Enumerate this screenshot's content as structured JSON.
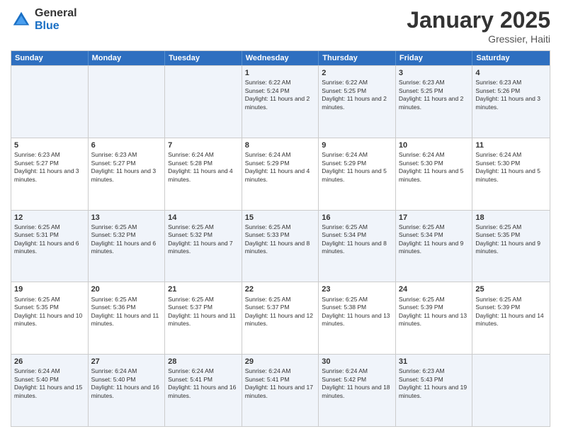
{
  "header": {
    "logo_general": "General",
    "logo_blue": "Blue",
    "month_title": "January 2025",
    "subtitle": "Gressier, Haiti"
  },
  "weekdays": [
    "Sunday",
    "Monday",
    "Tuesday",
    "Wednesday",
    "Thursday",
    "Friday",
    "Saturday"
  ],
  "rows": [
    [
      {
        "day": "",
        "info": ""
      },
      {
        "day": "",
        "info": ""
      },
      {
        "day": "",
        "info": ""
      },
      {
        "day": "1",
        "info": "Sunrise: 6:22 AM\nSunset: 5:24 PM\nDaylight: 11 hours and 2 minutes."
      },
      {
        "day": "2",
        "info": "Sunrise: 6:22 AM\nSunset: 5:25 PM\nDaylight: 11 hours and 2 minutes."
      },
      {
        "day": "3",
        "info": "Sunrise: 6:23 AM\nSunset: 5:25 PM\nDaylight: 11 hours and 2 minutes."
      },
      {
        "day": "4",
        "info": "Sunrise: 6:23 AM\nSunset: 5:26 PM\nDaylight: 11 hours and 3 minutes."
      }
    ],
    [
      {
        "day": "5",
        "info": "Sunrise: 6:23 AM\nSunset: 5:27 PM\nDaylight: 11 hours and 3 minutes."
      },
      {
        "day": "6",
        "info": "Sunrise: 6:23 AM\nSunset: 5:27 PM\nDaylight: 11 hours and 3 minutes."
      },
      {
        "day": "7",
        "info": "Sunrise: 6:24 AM\nSunset: 5:28 PM\nDaylight: 11 hours and 4 minutes."
      },
      {
        "day": "8",
        "info": "Sunrise: 6:24 AM\nSunset: 5:29 PM\nDaylight: 11 hours and 4 minutes."
      },
      {
        "day": "9",
        "info": "Sunrise: 6:24 AM\nSunset: 5:29 PM\nDaylight: 11 hours and 5 minutes."
      },
      {
        "day": "10",
        "info": "Sunrise: 6:24 AM\nSunset: 5:30 PM\nDaylight: 11 hours and 5 minutes."
      },
      {
        "day": "11",
        "info": "Sunrise: 6:24 AM\nSunset: 5:30 PM\nDaylight: 11 hours and 5 minutes."
      }
    ],
    [
      {
        "day": "12",
        "info": "Sunrise: 6:25 AM\nSunset: 5:31 PM\nDaylight: 11 hours and 6 minutes."
      },
      {
        "day": "13",
        "info": "Sunrise: 6:25 AM\nSunset: 5:32 PM\nDaylight: 11 hours and 6 minutes."
      },
      {
        "day": "14",
        "info": "Sunrise: 6:25 AM\nSunset: 5:32 PM\nDaylight: 11 hours and 7 minutes."
      },
      {
        "day": "15",
        "info": "Sunrise: 6:25 AM\nSunset: 5:33 PM\nDaylight: 11 hours and 8 minutes."
      },
      {
        "day": "16",
        "info": "Sunrise: 6:25 AM\nSunset: 5:34 PM\nDaylight: 11 hours and 8 minutes."
      },
      {
        "day": "17",
        "info": "Sunrise: 6:25 AM\nSunset: 5:34 PM\nDaylight: 11 hours and 9 minutes."
      },
      {
        "day": "18",
        "info": "Sunrise: 6:25 AM\nSunset: 5:35 PM\nDaylight: 11 hours and 9 minutes."
      }
    ],
    [
      {
        "day": "19",
        "info": "Sunrise: 6:25 AM\nSunset: 5:35 PM\nDaylight: 11 hours and 10 minutes."
      },
      {
        "day": "20",
        "info": "Sunrise: 6:25 AM\nSunset: 5:36 PM\nDaylight: 11 hours and 11 minutes."
      },
      {
        "day": "21",
        "info": "Sunrise: 6:25 AM\nSunset: 5:37 PM\nDaylight: 11 hours and 11 minutes."
      },
      {
        "day": "22",
        "info": "Sunrise: 6:25 AM\nSunset: 5:37 PM\nDaylight: 11 hours and 12 minutes."
      },
      {
        "day": "23",
        "info": "Sunrise: 6:25 AM\nSunset: 5:38 PM\nDaylight: 11 hours and 13 minutes."
      },
      {
        "day": "24",
        "info": "Sunrise: 6:25 AM\nSunset: 5:39 PM\nDaylight: 11 hours and 13 minutes."
      },
      {
        "day": "25",
        "info": "Sunrise: 6:25 AM\nSunset: 5:39 PM\nDaylight: 11 hours and 14 minutes."
      }
    ],
    [
      {
        "day": "26",
        "info": "Sunrise: 6:24 AM\nSunset: 5:40 PM\nDaylight: 11 hours and 15 minutes."
      },
      {
        "day": "27",
        "info": "Sunrise: 6:24 AM\nSunset: 5:40 PM\nDaylight: 11 hours and 16 minutes."
      },
      {
        "day": "28",
        "info": "Sunrise: 6:24 AM\nSunset: 5:41 PM\nDaylight: 11 hours and 16 minutes."
      },
      {
        "day": "29",
        "info": "Sunrise: 6:24 AM\nSunset: 5:41 PM\nDaylight: 11 hours and 17 minutes."
      },
      {
        "day": "30",
        "info": "Sunrise: 6:24 AM\nSunset: 5:42 PM\nDaylight: 11 hours and 18 minutes."
      },
      {
        "day": "31",
        "info": "Sunrise: 6:23 AM\nSunset: 5:43 PM\nDaylight: 11 hours and 19 minutes."
      },
      {
        "day": "",
        "info": ""
      }
    ]
  ],
  "alt_rows": [
    0,
    2,
    4
  ]
}
